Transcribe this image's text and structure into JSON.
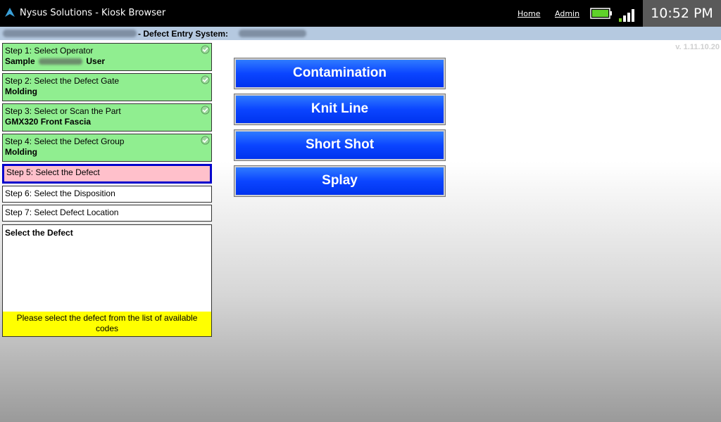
{
  "window": {
    "title": "Nysus Solutions - Kiosk Browser",
    "nav_links": [
      "Home",
      "Admin"
    ],
    "clock": "10:52 PM"
  },
  "header": {
    "title": "- Defect Entry System:",
    "version": "v. 1.11.10.20"
  },
  "steps": [
    {
      "label": "Step 1: Select Operator",
      "value_prefix": "Sample",
      "value_suffix": "User",
      "state": "done"
    },
    {
      "label": "Step 2: Select the Defect Gate",
      "value": "Molding",
      "state": "done"
    },
    {
      "label": "Step 3: Select or Scan the Part",
      "value": "GMX320 Front Fascia",
      "state": "done"
    },
    {
      "label": "Step 4: Select the Defect Group",
      "value": "Molding",
      "state": "done"
    },
    {
      "label": "Step 5: Select the Defect",
      "state": "active"
    },
    {
      "label": "Step 6: Select the Disposition",
      "state": "pending"
    },
    {
      "label": "Step 7: Select Defect Location",
      "state": "pending"
    }
  ],
  "instruction": {
    "title": "Select the Defect",
    "message": "Please select the defect from the list of available codes"
  },
  "defects": [
    "Contamination",
    "Knit Line",
    "Short Shot",
    "Splay"
  ],
  "colors": {
    "done": "#90ee90",
    "active": "#ffc0cb",
    "button": "#0b45ff",
    "message": "#ffff00"
  },
  "icons": {
    "app": "nysus-app-icon",
    "battery": "battery-icon",
    "signal": "signal-icon",
    "check": "check-circle-icon"
  }
}
